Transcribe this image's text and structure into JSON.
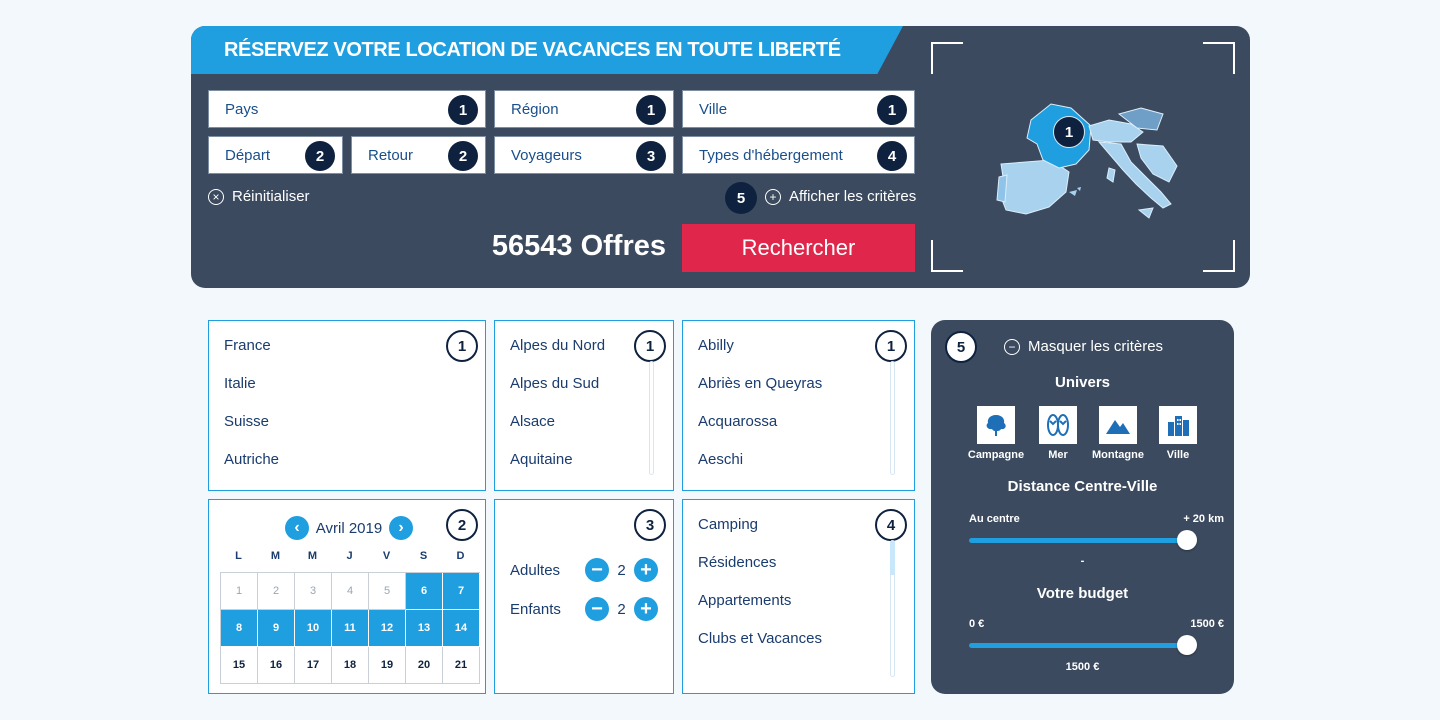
{
  "panel": {
    "title": "RÉSERVEZ VOTRE LOCATION DE VACANCES EN TOUTE LIBERTÉ",
    "fields": [
      {
        "label": "Pays",
        "count": "1"
      },
      {
        "label": "Région",
        "count": "1"
      },
      {
        "label": "Ville",
        "count": "1"
      },
      {
        "label": "Départ",
        "count": "2"
      },
      {
        "label": "Retour",
        "count": "2"
      },
      {
        "label": "Voyageurs",
        "count": "3"
      },
      {
        "label": "Types d'hébergement",
        "count": "4"
      }
    ],
    "reset_label": "Réinitialiser",
    "criteria_count": "5",
    "show_criteria_label": "Afficher les critères",
    "offers_label": "56543 Offres",
    "search_button": "Rechercher",
    "map_badge": "1"
  },
  "countries": {
    "badge": "1",
    "items": [
      "France",
      "Italie",
      "Suisse",
      "Autriche"
    ]
  },
  "regions": {
    "badge": "1",
    "items": [
      "Alpes du Nord",
      "Alpes du Sud",
      "Alsace",
      "Aquitaine"
    ]
  },
  "cities": {
    "badge": "1",
    "items": [
      "Abilly",
      "Abriès en Queyras",
      "Acquarossa",
      "Aeschi"
    ]
  },
  "calendar": {
    "badge": "2",
    "month": "Avril 2019",
    "weekdays": [
      "L",
      "M",
      "M",
      "J",
      "V",
      "S",
      "D"
    ],
    "days": [
      "1",
      "2",
      "3",
      "4",
      "5",
      "6",
      "7",
      "8",
      "9",
      "10",
      "11",
      "12",
      "13",
      "14",
      "15",
      "16",
      "17",
      "18",
      "19",
      "20",
      "21"
    ]
  },
  "travellers": {
    "badge": "3",
    "adults_label": "Adultes",
    "adults_value": "2",
    "children_label": "Enfants",
    "children_value": "2"
  },
  "accommodation": {
    "badge": "4",
    "items": [
      "Camping",
      "Résidences",
      "Appartements",
      "Clubs et Vacances"
    ]
  },
  "criteria": {
    "badge": "5",
    "hide_label": "Masquer les critères",
    "universe_title": "Univers",
    "universes": [
      {
        "label": "Campagne",
        "icon": "tree-icon"
      },
      {
        "label": "Mer",
        "icon": "flip-flops-icon"
      },
      {
        "label": "Montagne",
        "icon": "mountain-icon"
      },
      {
        "label": "Ville",
        "icon": "buildings-icon"
      }
    ],
    "distance_title": "Distance Centre-Ville",
    "distance_min_label": "Au centre",
    "distance_max_label": "+ 20 km",
    "distance_value_label": "-",
    "budget_title": "Votre budget",
    "budget_min_label": "0 €",
    "budget_max_label": "1500 €",
    "budget_value_label": "1500 €"
  },
  "colors": {
    "accent": "#1f9ee0",
    "panel": "#3b4a5e",
    "search_button": "#e0264a",
    "badge": "#0e2240"
  }
}
